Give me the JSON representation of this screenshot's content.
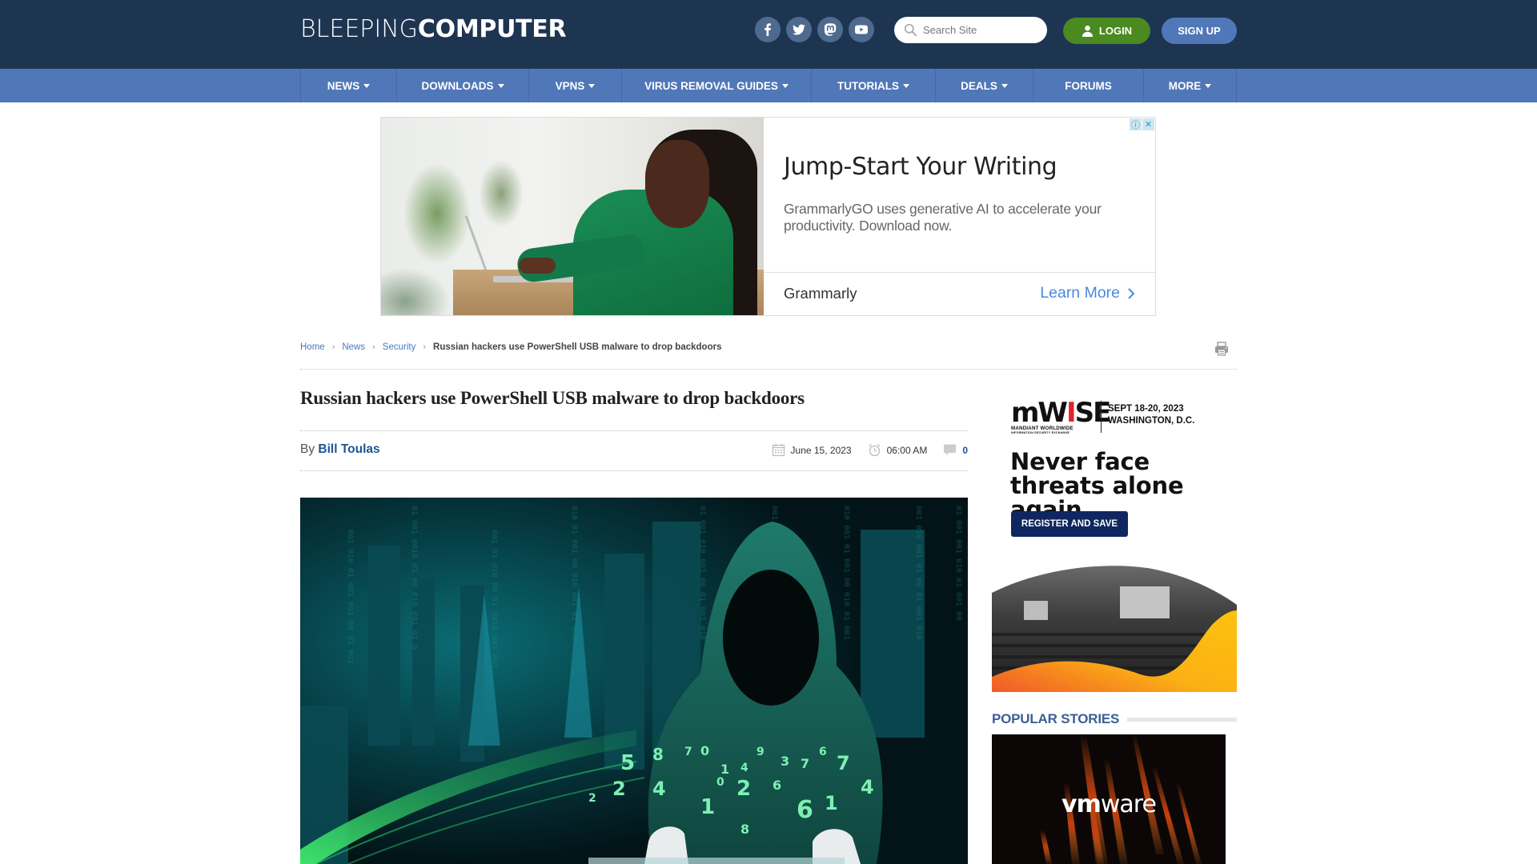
{
  "header": {
    "logo_light": "BLEEPING",
    "logo_bold": "COMPUTER",
    "social": [
      {
        "name": "facebook-icon"
      },
      {
        "name": "twitter-icon"
      },
      {
        "name": "mastodon-icon"
      },
      {
        "name": "youtube-icon"
      }
    ],
    "search_placeholder": "Search Site",
    "search_value": "",
    "login_label": "LOGIN",
    "signup_label": "SIGN UP"
  },
  "nav": {
    "items": [
      {
        "label": "NEWS",
        "dropdown": true
      },
      {
        "label": "DOWNLOADS",
        "dropdown": true
      },
      {
        "label": "VPNS",
        "dropdown": true
      },
      {
        "label": "VIRUS REMOVAL GUIDES",
        "dropdown": true
      },
      {
        "label": "TUTORIALS",
        "dropdown": true
      },
      {
        "label": "DEALS",
        "dropdown": true
      },
      {
        "label": "FORUMS",
        "dropdown": false
      },
      {
        "label": "MORE",
        "dropdown": true
      }
    ]
  },
  "ad_banner": {
    "title": "Jump-Start Your Writing",
    "description": "GrammarlyGO uses generative AI to accelerate your productivity. Download now.",
    "brand": "Grammarly",
    "cta": "Learn More",
    "info_glyph": "ⓘ",
    "close_glyph": "✕"
  },
  "breadcrumb": {
    "items": [
      "Home",
      "News",
      "Security"
    ],
    "current": "Russian hackers use PowerShell USB malware to drop backdoors",
    "separator": "›"
  },
  "article": {
    "title": "Russian hackers use PowerShell USB malware to drop backdoors",
    "by_label": "By",
    "author": "Bill Toulas",
    "date": "June 15, 2023",
    "time": "06:00 AM",
    "comments": "0"
  },
  "sidebar_ad": {
    "logo": "mWISE",
    "logo_sub1": "MANDIANT WORLDWIDE",
    "logo_sub2": "INFORMATION SECURITY EXCHANGE",
    "date_line1": "SEPT 18-20, 2023",
    "date_line2": "WASHINGTON, D.C.",
    "headline": "Never face threats alone again.",
    "button": "REGISTER AND SAVE",
    "colors": {
      "button_bg": "#0f2760",
      "wave_start": "#f0592a",
      "wave_end": "#fdc20e"
    }
  },
  "popular_stories": {
    "heading": "POPULAR STORIES",
    "first_image_logo_bold": "vm",
    "first_image_logo_light": "ware"
  },
  "colors": {
    "header_bg": "#1e3552",
    "nav_bg": "#5077b8",
    "login_bg": "#4a8a21",
    "signup_bg": "#5077b8",
    "link": "#4a78c0",
    "author_link": "#1c5595",
    "popular_heading": "#3c5f94"
  }
}
